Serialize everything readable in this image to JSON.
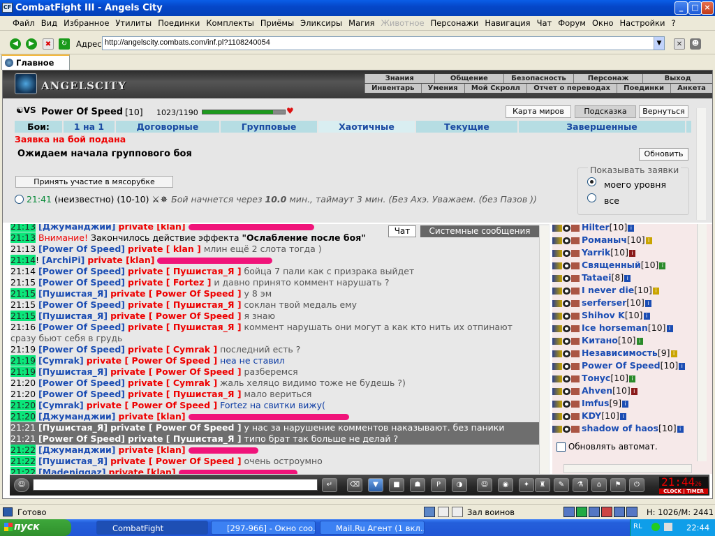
{
  "window": {
    "title": "CombatFight III - Angels City",
    "controls": [
      "_",
      "□",
      "×"
    ]
  },
  "menu": [
    "Файл",
    "Вид",
    "Избранное",
    "Утилиты",
    "Поединки",
    "Комплекты",
    "Приёмы",
    "Эликсиры",
    "Магия",
    "Животное",
    "Персонажи",
    "Навигация",
    "Чат",
    "Форум",
    "Окно",
    "Настройки",
    "?"
  ],
  "menu_disabled": "Животное",
  "address": {
    "label": "Адрес:",
    "url": "http://angelscity.combats.com/inf.pl?1108240054"
  },
  "tab": {
    "label": "Главное"
  },
  "header": {
    "logo": "ANGELSCITY",
    "nav_top": [
      "Знания",
      "Общение",
      "Безопасность",
      "Персонаж",
      "Выход"
    ],
    "nav_bottom": [
      "Инвентарь",
      "Умения",
      "Мой Скролл",
      "Отчет о переводах",
      "Поединки",
      "Анкета"
    ]
  },
  "player": {
    "name": "Power Of Speed",
    "level": "[10]",
    "hp": "1023/1190",
    "hp_fraction": 0.86
  },
  "panel_buttons": {
    "map": "Карта миров",
    "hint": "Подсказка",
    "back": "Вернуться"
  },
  "battle_tabs": {
    "label": "Бои:",
    "items": [
      "1 на 1",
      "Договорные",
      "Групповые",
      "Хаотичные",
      "Текущие",
      "Завершенные"
    ],
    "active": "Хаотичные"
  },
  "request": {
    "title": "Заявка на бой подана",
    "waiting": "Ожидаем начала группового боя",
    "refresh": "Обновить",
    "join": "Принять участие в мясорубке"
  },
  "show": {
    "title": "Показывать заявки",
    "opt1": "моего уровня",
    "opt2": "все"
  },
  "battle": {
    "time": "21:41",
    "who": "(неизвестно)",
    "range": "(10-10)",
    "text": "Бой начнется через",
    "minutes": "10.0",
    "rest": "мин., таймаут 3 мин. (Без Ахэ. Уважаем. (без Пазов ))"
  },
  "chat_tabs": {
    "chat": "Чат",
    "system": "Системные сообщения"
  },
  "chat": [
    {
      "t": "21:13",
      "nick": "[Джуманджии]",
      "pv": "private [klan]",
      "msg": "",
      "scrib": 180,
      "ts": true
    },
    {
      "t": "21:13",
      "warn": "Внимание!",
      "msg": "Закончилось действие эффекта",
      "bold": "\"Ослабление после боя\"",
      "ts": true
    },
    {
      "t": "21:13",
      "nick": "[Power Of Speed]",
      "pv": "private [ klan ]",
      "msg": "млин ещё 2 слота тогда )"
    },
    {
      "t": "21:14",
      "nick": "[ArchiPi]",
      "pv": "private [klan]",
      "msg": "",
      "scrib": 165,
      "ts": true,
      "excl": true
    },
    {
      "t": "21:14",
      "nick": "[Power Of Speed]",
      "pv": "private [ Пушистая_Я ]",
      "msg": "бойца 7 пали как с призрака выйдет"
    },
    {
      "t": "21:15",
      "nick": "[Power Of Speed]",
      "pv": "private [ Fortez ]",
      "msg": "и давно принято коммент нарушать ?"
    },
    {
      "t": "21:15",
      "nick": "[Пушистая_Я]",
      "pv": "private [ Power Of Speed ]",
      "msg": "у 8 эм",
      "ts": true
    },
    {
      "t": "21:15",
      "nick": "[Power Of Speed]",
      "pv": "private [ Пушистая_Я ]",
      "msg": "соклан твой медаль ему"
    },
    {
      "t": "21:15",
      "nick": "[Пушистая_Я]",
      "pv": "private [ Power Of Speed ]",
      "msg": "я знаю",
      "ts": true
    },
    {
      "t": "21:16",
      "nick": "[Power Of Speed]",
      "pv": "private [ Пушистая_Я ]",
      "msg": "коммент нарушать они могут а как кто нить их отпинают"
    },
    {
      "t": "",
      "cont": "сразу бьют себя в грудь"
    },
    {
      "t": "21:19",
      "nick": "[Power Of Speed]",
      "pv": "private [ Cymrak ]",
      "msg": "последний есть ?"
    },
    {
      "t": "21:19",
      "nick": "[Cymrak]",
      "pv": "private [ Power Of Speed ]",
      "msg": "неа не ставил",
      "ts": true,
      "blue": true
    },
    {
      "t": "21:19",
      "nick": "[Пушистая_Я]",
      "pv": "private [ Power Of Speed ]",
      "msg": "разберемся",
      "ts": true
    },
    {
      "t": "21:20",
      "nick": "[Power Of Speed]",
      "pv": "private [ Cymrak ]",
      "msg": "жаль хеляцо видимо тоже не будешь ?)"
    },
    {
      "t": "21:20",
      "nick": "[Power Of Speed]",
      "pv": "private [ Пушистая_Я ]",
      "msg": "мало вериться"
    },
    {
      "t": "21:20",
      "nick": "[Cymrak]",
      "pv": "private [ Power Of Speed ]",
      "msg": "Fortez на свитки вижу(",
      "ts": true,
      "blue": true
    },
    {
      "t": "21:20",
      "nick": "[Джуманджии]",
      "pv": "private [klan]",
      "msg": "",
      "scrib": 230,
      "ts": true
    },
    {
      "t": "21:21",
      "nick": "[Пушистая_Я]",
      "pv": "private [ Power Of Speed ]",
      "msg": "у нас за нарушение комментов наказывают. без паники",
      "hl": true
    },
    {
      "t": "21:21",
      "nick": "[Power Of Speed]",
      "pv": "private [ Пушистая_Я ]",
      "msg": "типо брат так больше не делай ?",
      "hl": true
    },
    {
      "t": "21:22",
      "nick": "[Джуманджии]",
      "pv": "private [klan]",
      "msg": "",
      "scrib": 100,
      "ts": true
    },
    {
      "t": "21:22",
      "nick": "[Пушистая_Я]",
      "pv": "private [ Power Of Speed ]",
      "msg": "очень остроумно",
      "ts": true
    },
    {
      "t": "21:22",
      "nick": "[Madeniqqaz]",
      "pv": "private [klan]",
      "msg": "",
      "scrib": 170,
      "ts": true
    }
  ],
  "users": [
    {
      "nick": "Hilter",
      "lvl": "[10]",
      "c": "#1b4db3"
    },
    {
      "nick": "Романыч",
      "lvl": "[10]",
      "c": "#c9a400"
    },
    {
      "nick": "Yarrik",
      "lvl": "[10]",
      "c": "#8a1a1a"
    },
    {
      "nick": "Священный",
      "lvl": "[10]",
      "c": "#2a8a2a"
    },
    {
      "nick": "Tataei",
      "lvl": "[8]",
      "c": "#1b4db3"
    },
    {
      "nick": "I never die",
      "lvl": "[10]",
      "c": "#c9a400"
    },
    {
      "nick": "serferser",
      "lvl": "[10]",
      "c": "#1b4db3"
    },
    {
      "nick": "Shihov K",
      "lvl": "[10]",
      "c": "#1b4db3"
    },
    {
      "nick": "Ice horseman",
      "lvl": "[10]",
      "c": "#1b4db3"
    },
    {
      "nick": "Китано",
      "lvl": "[10]",
      "c": "#2a8a2a"
    },
    {
      "nick": "Независимость",
      "lvl": "[9]",
      "c": "#c9a400"
    },
    {
      "nick": "Power Of Speed",
      "lvl": "[10]",
      "c": "#1b4db3"
    },
    {
      "nick": "Тонус",
      "lvl": "[10]",
      "c": "#2a8a2a"
    },
    {
      "nick": "Ahven",
      "lvl": "[10]",
      "c": "#8a1a1a"
    },
    {
      "nick": "Imfus",
      "lvl": "[9]",
      "c": "#1b4db3"
    },
    {
      "nick": "KDY",
      "lvl": "[10]",
      "c": "#1b4db3"
    },
    {
      "nick": "shadow of haos",
      "lvl": "[10]",
      "c": "#1b4db3"
    }
  ],
  "users_panel": {
    "auto": "Обновлять автомат."
  },
  "clock": {
    "time": "21:44",
    "sec": "26",
    "labels": "CLOCK | TIMER"
  },
  "status": {
    "ready": "Готово",
    "place": "Зал воинов",
    "coords": "Н: 1026/М: 2441"
  },
  "taskbar": {
    "start": "пуск",
    "tasks": [
      "CombatFight",
      "[297-966] - Окно соо...",
      "Mail.Ru Агент (1 вкл..."
    ],
    "lang": "RL",
    "time": "22:44"
  }
}
